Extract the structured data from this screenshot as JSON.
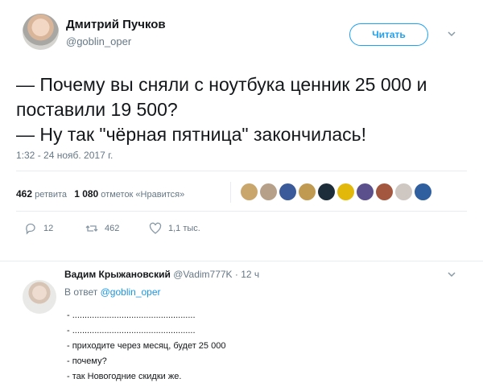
{
  "tweet": {
    "author_name": "Дмитрий Пучков",
    "author_handle": "@goblin_oper",
    "follow_label": "Читать",
    "text_line1": "— Почему вы сняли с ноутбука ценник 25 000 и поставили 19 500?",
    "text_line2": "— Ну так \"чёрная пятница\" закончилась!",
    "timestamp": "1:32 - 24 нояб. 2017 г.",
    "retweets_count": "462",
    "retweets_label": "ретвита",
    "likes_count": "1 080",
    "likes_label": "отметок «Нравится»",
    "actions": {
      "reply_count": "12",
      "retweet_count": "462",
      "like_count": "1,1 тыс."
    },
    "liker_colors": [
      "#c9a66b",
      "#b6a08a",
      "#3b5a99",
      "#c09a50",
      "#1e2d3a",
      "#e2b80b",
      "#5b4f8c",
      "#a4573f",
      "#cfc7c2",
      "#2f5f9e"
    ]
  },
  "reply": {
    "author_name": "Вадим Крыжановский",
    "author_handle": "@Vadim777K",
    "time": "· 12 ч",
    "reply_to_prefix": "В ответ",
    "reply_to_handle": "@goblin_oper",
    "lines": [
      "- ..................................................",
      "- ..................................................",
      "- приходите через месяц, будет 25 000",
      "- почему?",
      "- так Новогодние скидки же."
    ]
  }
}
